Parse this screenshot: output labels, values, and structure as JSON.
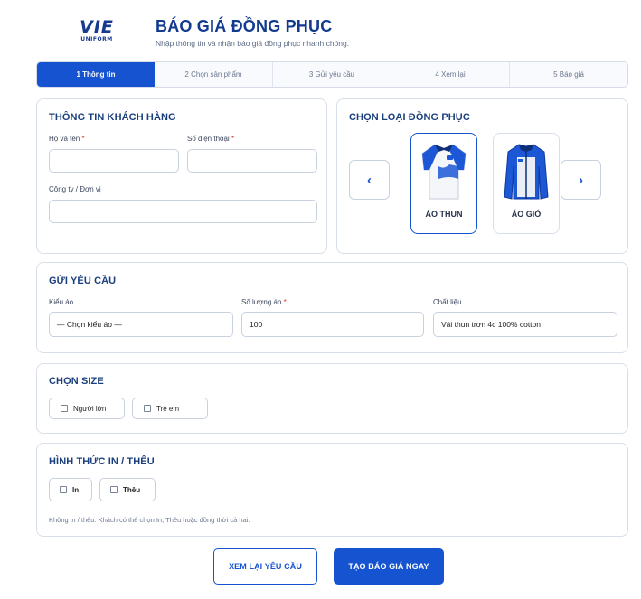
{
  "header": {
    "logo_text": "VIE",
    "logo_sub": "UNIFORM",
    "title": "BÁO GIÁ ĐỒNG PHỤC",
    "subtitle": "Nhập thông tin và nhận báo giá đồng phục nhanh chóng."
  },
  "steps": [
    {
      "label": "1 Thông tin",
      "active": true
    },
    {
      "label": "2 Chọn sản phẩm",
      "active": false
    },
    {
      "label": "3 Gửi yêu cầu",
      "active": false
    },
    {
      "label": "4 Xem lại",
      "active": false
    },
    {
      "label": "5 Báo giá",
      "active": false
    }
  ],
  "customer": {
    "title": "THÔNG TIN KHÁCH HÀNG",
    "name_label": "Họ và tên",
    "name_value": "",
    "phone_label": "Số điện thoại",
    "phone_value": "",
    "company_label": "Công ty / Đơn vị",
    "company_value": "",
    "required_mark": "*"
  },
  "product_type": {
    "title": "CHỌN LOẠI ĐỒNG PHỤC",
    "prev_icon": "chevron-left-icon",
    "next_icon": "chevron-right-icon",
    "prev_glyph": "‹",
    "next_glyph": "›",
    "items": [
      {
        "name": "ÁO THUN",
        "selected": true,
        "image": "polo-shirt-icon"
      },
      {
        "name": "ÁO GIÓ",
        "selected": false,
        "image": "windbreaker-jacket-icon"
      }
    ]
  },
  "request": {
    "title": "GỬI YÊU CẦU",
    "type_label": "Kiểu áo",
    "type_value": "— Chọn kiểu áo —",
    "qty_label": "Số lượng áo",
    "qty_value": "100",
    "material_label": "Chất liệu",
    "material_value": "Vải thun trơn 4c 100% cotton"
  },
  "size": {
    "title": "CHỌN SIZE",
    "options": [
      {
        "label": "Người lớn",
        "checked": false
      },
      {
        "label": "Trẻ em",
        "checked": false
      }
    ]
  },
  "print": {
    "title": "HÌNH THỨC IN / THÊU",
    "options": [
      {
        "label": "In",
        "checked": false
      },
      {
        "label": "Thêu",
        "checked": false
      }
    ],
    "note": "Không in / thêu. Khách có thể chọn In, Thêu hoặc đồng thời cả hai."
  },
  "actions": {
    "review_label": "XEM LẠI YÊU CẦU",
    "quote_label": "TẠO BÁO GIÁ NGAY"
  },
  "colors": {
    "primary": "#1553d0",
    "title": "#123a8f",
    "border": "#d9dfe9",
    "required": "#e0322b"
  }
}
